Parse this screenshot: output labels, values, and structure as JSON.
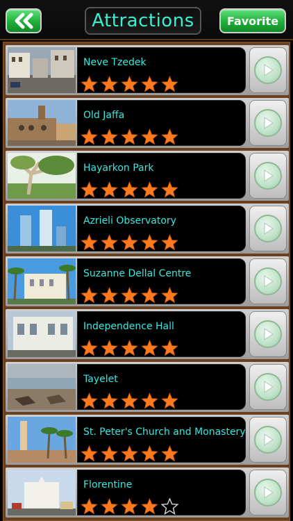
{
  "header": {
    "back_icon": "double-chevron-left-icon",
    "title": "Attractions",
    "favorite_label": "Favorite",
    "title_color": "#39f0d0",
    "button_color": "#1fae3a"
  },
  "list": {
    "items": [
      {
        "name": "Neve Tzedek",
        "rating": 5,
        "thumb": "street-photo"
      },
      {
        "name": "Old Jaffa",
        "rating": 5,
        "thumb": "old-building-photo"
      },
      {
        "name": "Hayarkon Park",
        "rating": 5,
        "thumb": "park-tree-photo"
      },
      {
        "name": "Azrieli Observatory",
        "rating": 5,
        "thumb": "towers-photo"
      },
      {
        "name": "Suzanne Dellal Centre",
        "rating": 5,
        "thumb": "palm-building-photo"
      },
      {
        "name": "Independence Hall",
        "rating": 5,
        "thumb": "white-building-photo"
      },
      {
        "name": "Tayelet",
        "rating": 5,
        "thumb": "beach-photo"
      },
      {
        "name": "St. Peter's Church and Monastery",
        "rating": 5,
        "thumb": "church-tower-photo"
      },
      {
        "name": "Florentine",
        "rating": 4,
        "thumb": "street-corner-photo"
      }
    ],
    "star_color": "#ff7a1f",
    "name_color": "#39e8e0",
    "go_icon": "play-arrow-icon"
  }
}
